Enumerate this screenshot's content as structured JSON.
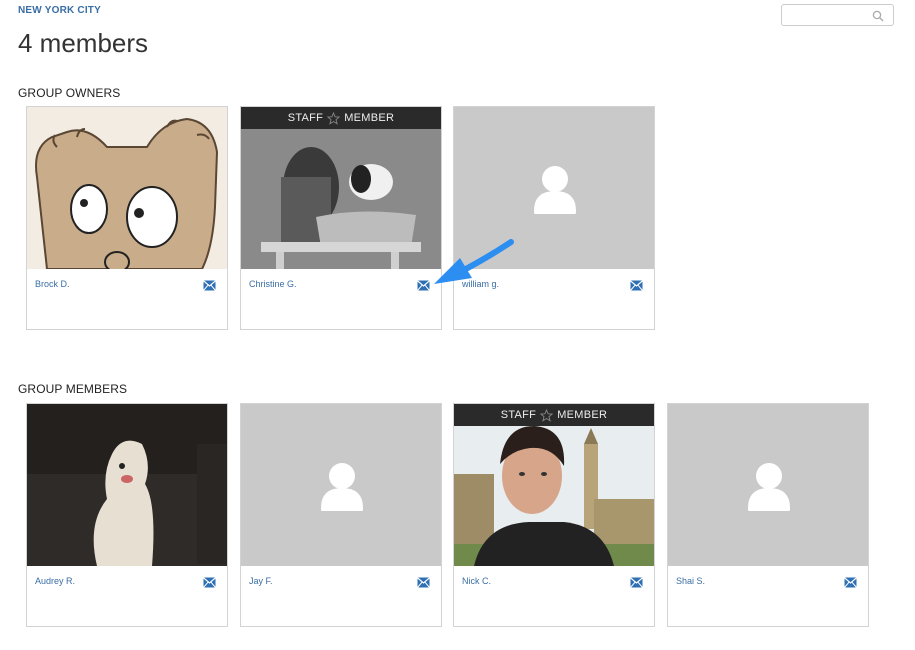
{
  "breadcrumb": "NEW YORK CITY",
  "title": "4 members",
  "search": {
    "placeholder": ""
  },
  "owners_section": {
    "label": "GROUP OWNERS",
    "members": [
      {
        "name": "Brock D.",
        "photo": "cartoon-dog",
        "staff": false
      },
      {
        "name": "Christine G.",
        "photo": "vintage-dogs-tub",
        "staff": true
      },
      {
        "name": "william g.",
        "photo": "default-avatar",
        "staff": false
      }
    ]
  },
  "members_section": {
    "label": "GROUP MEMBERS",
    "members": [
      {
        "name": "Audrey R.",
        "photo": "white-dog",
        "staff": false
      },
      {
        "name": "Jay F.",
        "photo": "default-avatar",
        "staff": false
      },
      {
        "name": "Nick C.",
        "photo": "selfie-big-ben",
        "staff": true
      },
      {
        "name": "Shai S.",
        "photo": "default-avatar",
        "staff": false
      }
    ]
  },
  "staff_badge": {
    "left": "STAFF",
    "right": "MEMBER",
    "icon": "star-icon"
  },
  "colors": {
    "link": "#3a6ea5",
    "banner": "#2a2a2a",
    "placeholder_bg": "#c9c9c9",
    "arrow": "#2b8ef0"
  }
}
